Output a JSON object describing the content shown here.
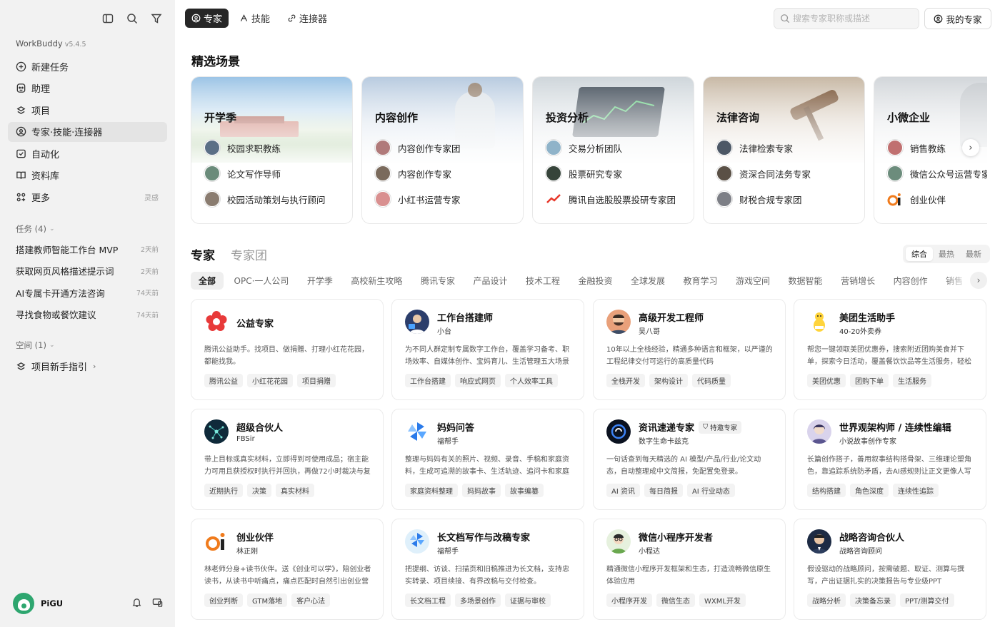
{
  "app": {
    "name": "WorkBuddy",
    "version": "v5.4.5"
  },
  "sidebar": {
    "menu": [
      {
        "label": "新建任务",
        "icon": "plus-circle-icon"
      },
      {
        "label": "助理",
        "icon": "assistant-icon"
      },
      {
        "label": "项目",
        "icon": "project-icon"
      },
      {
        "label": "专家·技能·连接器",
        "icon": "expert-icon",
        "active": true
      },
      {
        "label": "自动化",
        "icon": "automation-icon"
      },
      {
        "label": "资料库",
        "icon": "library-icon"
      },
      {
        "label": "更多",
        "icon": "more-grid-icon",
        "tail": "灵感"
      }
    ],
    "tasks_header": "任务 (4)",
    "tasks": [
      {
        "label": "搭建教师智能工作台 MVP",
        "time": "2天前"
      },
      {
        "label": "获取网页风格描述提示词",
        "time": "2天前"
      },
      {
        "label": "AI专属卡开通方法咨询",
        "time": "74天前"
      },
      {
        "label": "寻找食物或餐饮建议",
        "time": "74天前"
      }
    ],
    "space_header": "空间 (1)",
    "spaces": [
      {
        "label": "项目新手指引"
      }
    ],
    "user": {
      "name": "PiGU"
    }
  },
  "topnav": {
    "tabs": [
      "专家",
      "技能",
      "连接器"
    ],
    "active": 0
  },
  "search": {
    "placeholder": "搜索专家职称或描述"
  },
  "my_experts": "我的专家",
  "featured_title": "精选场景",
  "scenes": [
    {
      "title": "开学季",
      "items": [
        "校园求职教练",
        "论文写作导师",
        "校园活动策划与执行顾问"
      ]
    },
    {
      "title": "内容创作",
      "items": [
        "内容创作专家团",
        "内容创作专家",
        "小红书运营专家"
      ]
    },
    {
      "title": "投资分析",
      "items": [
        "交易分析团队",
        "股票研究专家",
        "腾讯自选股股票投研专家团"
      ]
    },
    {
      "title": "法律咨询",
      "items": [
        "法律检索专家",
        "资深合同法务专家",
        "财税合规专家团"
      ]
    },
    {
      "title": "小微企业",
      "items": [
        "销售教练",
        "微信公众号运营专家",
        "创业伙伴"
      ]
    }
  ],
  "expert_tabs": [
    "专家",
    "专家团"
  ],
  "sort_options": [
    "综合",
    "最热",
    "最新"
  ],
  "categories": [
    "全部",
    "OPC·一人公司",
    "开学季",
    "高校新生攻略",
    "腾讯专家",
    "产品设计",
    "技术工程",
    "金融投资",
    "全球发展",
    "教育学习",
    "游戏空间",
    "数据智能",
    "营销增长",
    "内容创作",
    "销售"
  ],
  "experts": [
    {
      "name": "公益专家",
      "sub": "",
      "desc": "腾讯公益助手。找项目、做捐赠、打理小红花花园，都能找我。",
      "tags": [
        "腾讯公益",
        "小红花花园",
        "项目捐赠"
      ]
    },
    {
      "name": "工作台搭建师",
      "sub": "小台",
      "desc": "为不同人群定制专属数字工作台，覆盖学习备考、职场效率、自媒体创作、宝妈育儿、生活管理五大场景",
      "tags": [
        "工作台搭建",
        "响应式网页",
        "个人效率工具"
      ]
    },
    {
      "name": "高级开发工程师",
      "sub": "吴八哥",
      "desc": "10年以上全栈经验，精通多种语言和框架，以严谨的工程纪律交付可运行的高质量代码",
      "tags": [
        "全栈开发",
        "架构设计",
        "代码质量"
      ]
    },
    {
      "name": "美团生活助手",
      "sub": "40-20外卖券",
      "desc": "帮您一键领取美团优惠券，搜索附近团购美食并下单，探索今日活动，覆盖餐饮饮品等生活服务，轻松省钱",
      "tags": [
        "美团优惠",
        "团购下单",
        "生活服务"
      ]
    },
    {
      "name": "超级合伙人",
      "sub": "FBSir",
      "desc": "带上目标或真实材料，立即得到可使用成品；宿主能力可用且获授权时执行并回执，再做72小时裁决与复盘",
      "tags": [
        "近期执行",
        "决策",
        "真实材料"
      ]
    },
    {
      "name": "妈妈问答",
      "sub": "福帮手",
      "desc": "整理与妈妈有关的照片、视频、录音、手稿和家庭资料，生成可追溯的故事卡、生活轨迹、追问卡和家庭档案",
      "tags": [
        "家庭资料整理",
        "妈妈故事",
        "故事编纂"
      ]
    },
    {
      "name": "资讯速递专家",
      "sub": "数字生命卡兹克",
      "badge": "特邀专家",
      "desc": "一句话查到每天精选的 AI 模型/产品/行业/论文动态，自动整理成中文简报，免配置免登录。",
      "tags": [
        "AI 资讯",
        "每日简报",
        "AI 行业动态"
      ]
    },
    {
      "name": "世界观架构师 / 连续性编辑",
      "sub": "小说故事创作专家",
      "desc": "长篇创作搭子，善用叙事结构搭骨架、三维理论塑角色，靠追踪系统防矛盾，去AI感规则让正文更像人写的",
      "tags": [
        "结构搭建",
        "角色深度",
        "连续性追踪"
      ]
    },
    {
      "name": "创业伙伴",
      "sub": "林正刚",
      "desc": "林老师分身+读书伙伴。送《创业可以学》，陪创业者读书，从读书中听痛点，痛点匹配时自然引出创业营",
      "tags": [
        "创业判断",
        "GTM落地",
        "客户心法"
      ]
    },
    {
      "name": "长文档写作与改稿专家",
      "sub": "福帮手",
      "desc": "把提纲、访谈、扫描页和旧稿推进为长文档，支持忠实转录、项目续接、有界改稿与交付检查。",
      "tags": [
        "长文档工程",
        "多场景创作",
        "证据与审校"
      ]
    },
    {
      "name": "微信小程序开发者",
      "sub": "小程达",
      "desc": "精通微信小程序开发框架和生态，打造流畅微信原生体验应用",
      "tags": [
        "小程序开发",
        "微信生态",
        "WXML开发"
      ]
    },
    {
      "name": "战略咨询合伙人",
      "sub": "战略咨询顾问",
      "desc": "假设驱动的战略顾问，按需破题、取证、测算与撰写，产出证据扎实的决策报告与专业级PPT",
      "tags": [
        "战略分析",
        "决策备忘录",
        "PPT/测算交付"
      ]
    }
  ]
}
